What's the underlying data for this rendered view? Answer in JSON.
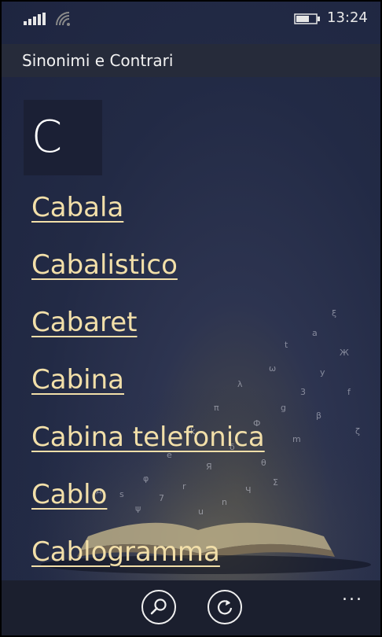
{
  "status_bar": {
    "time": "13:24",
    "signal_icon": "signal-icon",
    "wifi_icon": "wifi-icon",
    "battery_icon": "battery-icon"
  },
  "header": {
    "title": "Sinonimi e Contrari"
  },
  "letter_section": {
    "letter": "C"
  },
  "words": [
    "Cabala",
    "Cabalistico",
    "Cabaret",
    "Cabina",
    "Cabina telefonica",
    "Cablo",
    "Cablogramma"
  ],
  "app_bar": {
    "search_icon": "search-icon",
    "refresh_icon": "refresh-icon",
    "more_label": "..."
  },
  "colors": {
    "link": "#f2dfa9",
    "background": "#222a45",
    "title_bar": "#262b3a",
    "app_bar": "#1b1f2e"
  }
}
